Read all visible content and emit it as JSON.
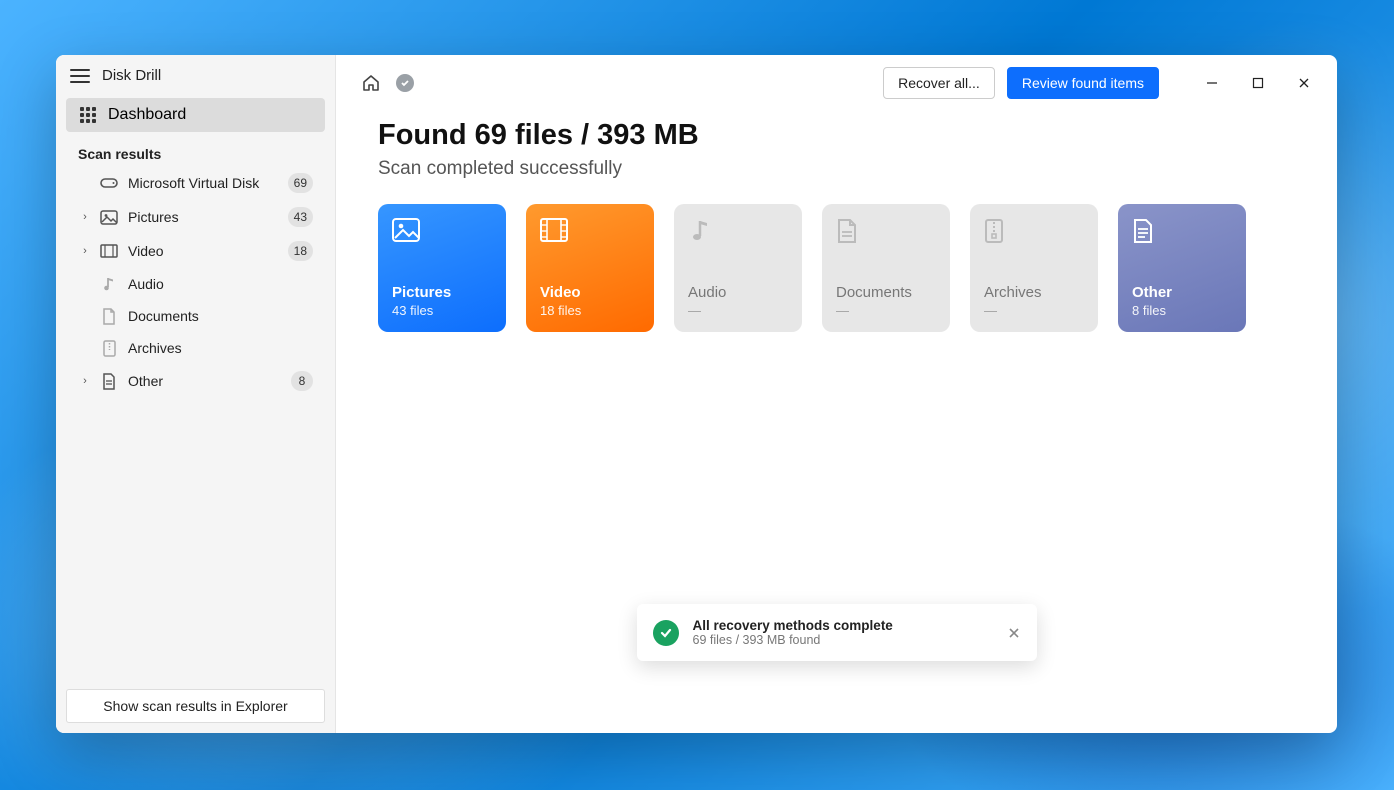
{
  "app": {
    "title": "Disk Drill"
  },
  "sidebar": {
    "dashboard_label": "Dashboard",
    "section_label": "Scan results",
    "items": [
      {
        "label": "Microsoft Virtual Disk",
        "count": "69",
        "expandable": false
      },
      {
        "label": "Pictures",
        "count": "43",
        "expandable": true
      },
      {
        "label": "Video",
        "count": "18",
        "expandable": true
      },
      {
        "label": "Audio",
        "count": "",
        "expandable": false
      },
      {
        "label": "Documents",
        "count": "",
        "expandable": false
      },
      {
        "label": "Archives",
        "count": "",
        "expandable": false
      },
      {
        "label": "Other",
        "count": "8",
        "expandable": true
      }
    ],
    "footer_button": "Show scan results in Explorer"
  },
  "topbar": {
    "recover_all": "Recover all...",
    "review": "Review found items"
  },
  "main": {
    "title": "Found 69 files / 393 MB",
    "subtitle": "Scan completed successfully"
  },
  "cards": {
    "pictures": {
      "title": "Pictures",
      "sub": "43 files"
    },
    "video": {
      "title": "Video",
      "sub": "18 files"
    },
    "audio": {
      "title": "Audio",
      "sub": "—"
    },
    "documents": {
      "title": "Documents",
      "sub": "—"
    },
    "archives": {
      "title": "Archives",
      "sub": "—"
    },
    "other": {
      "title": "Other",
      "sub": "8 files"
    }
  },
  "toast": {
    "title": "All recovery methods complete",
    "sub": "69 files / 393 MB found"
  }
}
